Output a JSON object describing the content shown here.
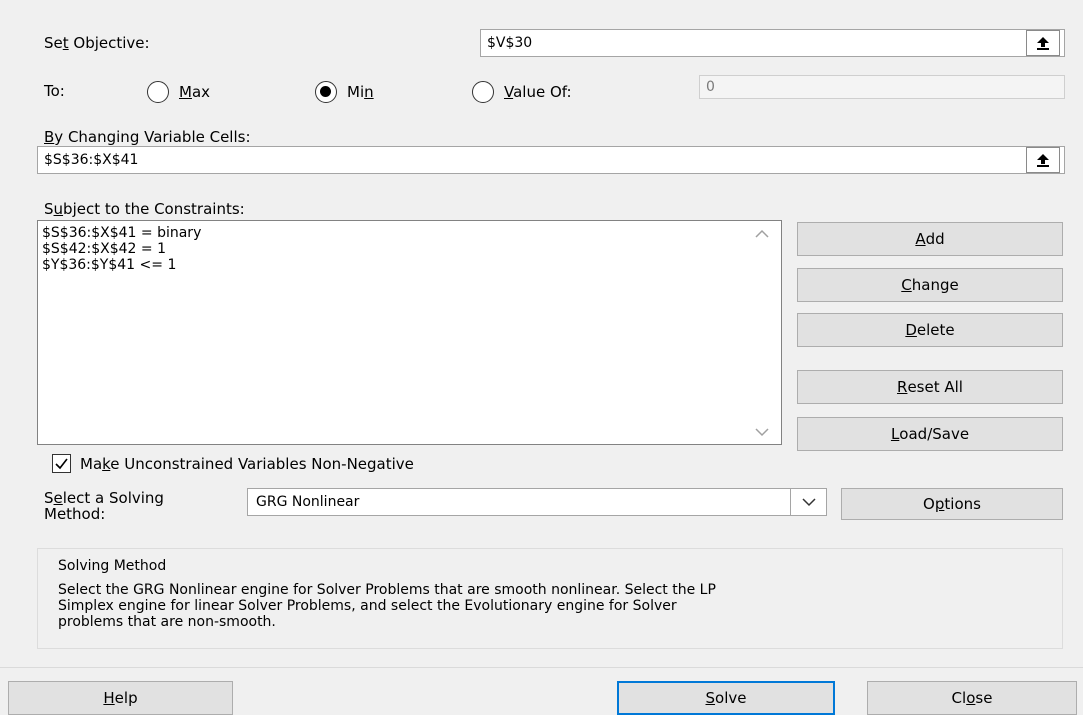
{
  "objective": {
    "label_pre": "Se",
    "label_key": "t",
    "label_post": " Objective:",
    "value": "$V$30"
  },
  "to": {
    "label": "To:",
    "max_pre": "",
    "max_key": "M",
    "max_post": "ax",
    "min_pre": "Mi",
    "min_key": "n",
    "min_post": "",
    "valueof_pre": "",
    "valueof_key": "V",
    "valueof_post": "alue Of:",
    "selected": "Min",
    "value_of_field": "0"
  },
  "changing": {
    "label_key": "B",
    "label_post": "y Changing Variable Cells:",
    "value": "$S$36:$X$41"
  },
  "constraints": {
    "label_pre": "S",
    "label_key": "u",
    "label_post": "bject to the Constraints:",
    "items": [
      "$S$36:$X$41 = binary",
      "$S$42:$X$42 = 1",
      "$Y$36:$Y$41 <= 1"
    ]
  },
  "buttons": {
    "add": {
      "key": "A",
      "post": "dd"
    },
    "change": {
      "key": "C",
      "post": "hange"
    },
    "delete": {
      "key": "D",
      "post": "elete"
    },
    "reset": {
      "key": "R",
      "post": "eset All"
    },
    "load": {
      "key": "L",
      "post": "oad/Save"
    },
    "options": {
      "pre": "O",
      "key": "p",
      "post": "tions"
    },
    "help": {
      "key": "H",
      "post": "elp"
    },
    "solve": {
      "key": "S",
      "post": "olve"
    },
    "close": {
      "pre": "Cl",
      "key": "o",
      "post": "se"
    }
  },
  "nonneg": {
    "checked": true,
    "label_pre": "Ma",
    "label_key": "k",
    "label_post": "e Unconstrained Variables Non-Negative"
  },
  "method": {
    "label_line1_pre": "S",
    "label_line1_key": "e",
    "label_line1_post": "lect a Solving",
    "label_line2": "Method:",
    "selected": "GRG Nonlinear"
  },
  "solving_method": {
    "title": "Solving Method",
    "line1": "Select the GRG Nonlinear engine for Solver Problems that are smooth nonlinear. Select the LP",
    "line2": "Simplex engine for linear Solver Problems, and select the Evolutionary engine for Solver",
    "line3": "problems that are non-smooth."
  },
  "icons": {
    "ref": "collapse-dialog-icon",
    "scroll_up": "scroll-up-icon",
    "scroll_down": "scroll-down-icon",
    "dropdown": "chevron-down-icon",
    "check": "checkmark-icon"
  }
}
